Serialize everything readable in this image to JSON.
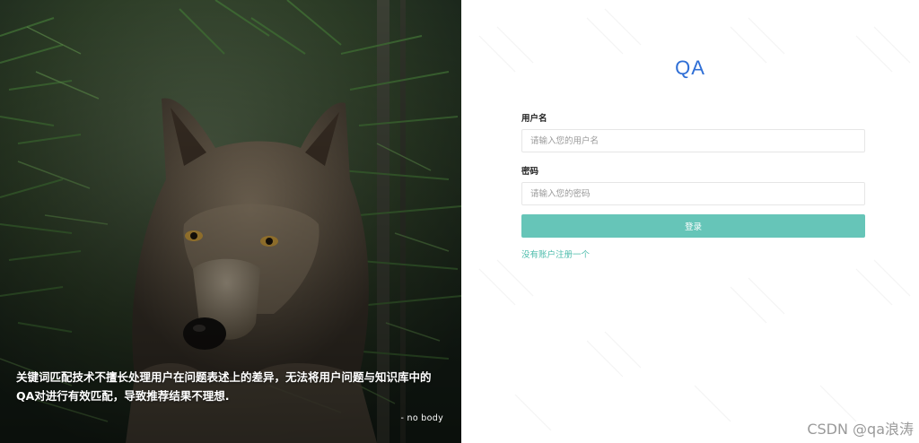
{
  "hero": {
    "quote": "关键词匹配技术不擅长处理用户在问题表述上的差异，无法将用户问题与知识库中的QA对进行有效匹配，导致推荐结果不理想.",
    "author": "- no body",
    "image_subject": "wolf in pine forest"
  },
  "login": {
    "brand": "QA",
    "username_label": "用户名",
    "username_placeholder": "请输入您的用户名",
    "password_label": "密码",
    "password_placeholder": "请输入您的密码",
    "submit_label": "登录",
    "register_link": "没有账户注册一个"
  },
  "watermark": "CSDN @qa浪涛",
  "colors": {
    "brand": "#2f6fd6",
    "button": "#66c5b8",
    "link": "#4cbcab",
    "input_border": "#e6e6e6"
  }
}
